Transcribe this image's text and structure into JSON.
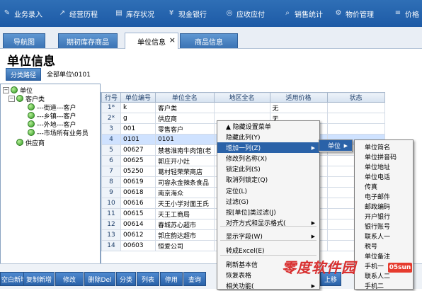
{
  "topnav": [
    {
      "label": "业务录入",
      "icon": "edit-icon"
    },
    {
      "label": "经营历程",
      "icon": "chart-icon"
    },
    {
      "label": "库存状况",
      "icon": "warehouse-icon"
    },
    {
      "label": "现金银行",
      "icon": "yen-icon"
    },
    {
      "label": "应收应付",
      "icon": "coin-icon"
    },
    {
      "label": "销售统计",
      "icon": "search-icon"
    },
    {
      "label": "物价管理",
      "icon": "gear-icon"
    },
    {
      "label": "价格",
      "icon": "list-icon"
    }
  ],
  "tabs": [
    {
      "label": "导航图"
    },
    {
      "label": "期初库存商品"
    },
    {
      "label": "单位信息"
    },
    {
      "label": "商品信息"
    }
  ],
  "tab_close": "×",
  "page_title": "单位信息",
  "path_button": "分类路径",
  "path_text": "全部单位\\0101",
  "tree": [
    {
      "label": "单位",
      "expander": "−"
    },
    {
      "label": "客户类",
      "expander": "−"
    },
    {
      "label": "---街道---客户",
      "expander": ""
    },
    {
      "label": "---乡镇---客户",
      "expander": ""
    },
    {
      "label": "---外地---客户",
      "expander": ""
    },
    {
      "label": "---市场所有业务员",
      "expander": ""
    },
    {
      "label": "供应商",
      "expander": ""
    }
  ],
  "grid": {
    "headers": [
      "行号",
      "单位编号",
      "单位全名",
      "地区全名",
      "适用价格",
      "状态"
    ],
    "rows": [
      {
        "rn": "1*",
        "code": "k",
        "name": "客户类",
        "region": "",
        "price": "无",
        "status": ""
      },
      {
        "rn": "2*",
        "code": "g",
        "name": "供应商",
        "region": "",
        "price": "无",
        "status": ""
      },
      {
        "rn": "3",
        "code": "001",
        "name": "零售客户",
        "region": "",
        "price": "",
        "status": ""
      },
      {
        "rn": "4",
        "code": "0101",
        "name": "0101",
        "region": "",
        "price": "",
        "status": ""
      },
      {
        "rn": "5",
        "code": "00627",
        "name": "禁巷淮南牛肉馆(老",
        "region": "",
        "price": "",
        "status": ""
      },
      {
        "rn": "6",
        "code": "00625",
        "name": "郭庄开小灶",
        "region": "",
        "price": "",
        "status": ""
      },
      {
        "rn": "7",
        "code": "05250",
        "name": "葛村轻荣荣商店",
        "region": "",
        "price": "",
        "status": ""
      },
      {
        "rn": "8",
        "code": "00619",
        "name": "司容永金辣条食品",
        "region": "",
        "price": "",
        "status": ""
      },
      {
        "rn": "9",
        "code": "00618",
        "name": "南京海众",
        "region": "",
        "price": "",
        "status": ""
      },
      {
        "rn": "10",
        "code": "00616",
        "name": "天王小学对面王氏",
        "region": "",
        "price": "",
        "status": ""
      },
      {
        "rn": "11",
        "code": "00615",
        "name": "天王工商局",
        "region": "",
        "price": "",
        "status": ""
      },
      {
        "rn": "12",
        "code": "00614",
        "name": "春城苏心超市",
        "region": "",
        "price": "",
        "status": ""
      },
      {
        "rn": "13",
        "code": "00612",
        "name": "郭庄韵达超市",
        "region": "",
        "price": "",
        "status": ""
      },
      {
        "rn": "14",
        "code": "00603",
        "name": "恒爱公司",
        "region": "",
        "price": "",
        "status": ""
      }
    ]
  },
  "context_menu": {
    "items": [
      {
        "label": "▲ 隐藏设置菜单",
        "sub": false
      },
      {
        "label": "隐藏此列(Y)",
        "sub": false
      },
      {
        "label": "增加一列(Z)",
        "sub": true
      },
      {
        "label": "修改列名称(X)",
        "sub": false
      },
      {
        "label": "锁定此列(S)",
        "sub": false
      },
      {
        "label": "取消列锁定(Q)",
        "sub": false
      },
      {
        "label": "定位(L)",
        "sub": false
      },
      {
        "label": "过滤(G)",
        "sub": false
      },
      {
        "label": "按[单位]类过滤(J)",
        "sub": false
      },
      {
        "label": "对齐方式和显示格式(",
        "sub": true
      },
      {
        "label": "显示字段(W)",
        "sub": true
      },
      {
        "label": "转成Excel(E)",
        "sub": false
      },
      {
        "label": "刷新基本信",
        "sub": false
      },
      {
        "label": "恢复表格",
        "sub": false
      },
      {
        "label": "相关功能(",
        "sub": true
      }
    ]
  },
  "submenu1": {
    "label": "单位"
  },
  "submenu2": {
    "items": [
      "单位简名",
      "单位拼音码",
      "单位地址",
      "单位电话",
      "传真",
      "电子邮件",
      "邮政编码",
      "开户银行",
      "银行账号",
      "联系人一",
      "税号",
      "单位备注",
      "手机一",
      "联系人二",
      "手机二"
    ]
  },
  "bottom_buttons": [
    "空白新增",
    "复制新增",
    "修改",
    "删除Del",
    "分类",
    "列表",
    "停用",
    "查询",
    "上移"
  ],
  "watermark": {
    "text": "零度软件园",
    "logo": "05sun"
  }
}
